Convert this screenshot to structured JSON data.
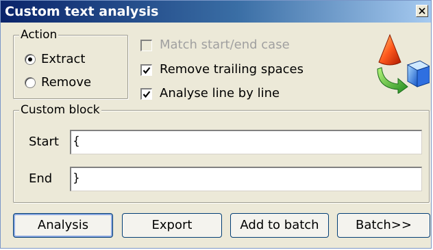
{
  "window": {
    "title": "Custom text analysis"
  },
  "action_group": {
    "legend": "Action",
    "options": [
      {
        "label": "Extract",
        "selected": true
      },
      {
        "label": "Remove",
        "selected": false
      }
    ]
  },
  "options": {
    "match_case": {
      "label": "Match start/end case",
      "checked": false,
      "enabled": false
    },
    "remove_trailing": {
      "label": "Remove trailing spaces",
      "checked": true,
      "enabled": true
    },
    "line_by_line": {
      "label": "Analyse line by line",
      "checked": true,
      "enabled": true
    }
  },
  "custom_block": {
    "legend": "Custom block",
    "start_label": "Start",
    "start_value": "{",
    "end_label": "End",
    "end_value": "}"
  },
  "buttons": {
    "analysis": "Analysis",
    "export": "Export",
    "add_to_batch": "Add to batch",
    "batch": "Batch>>"
  },
  "icons": {
    "close": "close-icon",
    "logo": "app-logo-icon"
  },
  "colors": {
    "titlebar_start": "#0a246a",
    "titlebar_end": "#a6caf0",
    "window_bg": "#ece9d8",
    "disabled_text": "#a0a0a0"
  }
}
